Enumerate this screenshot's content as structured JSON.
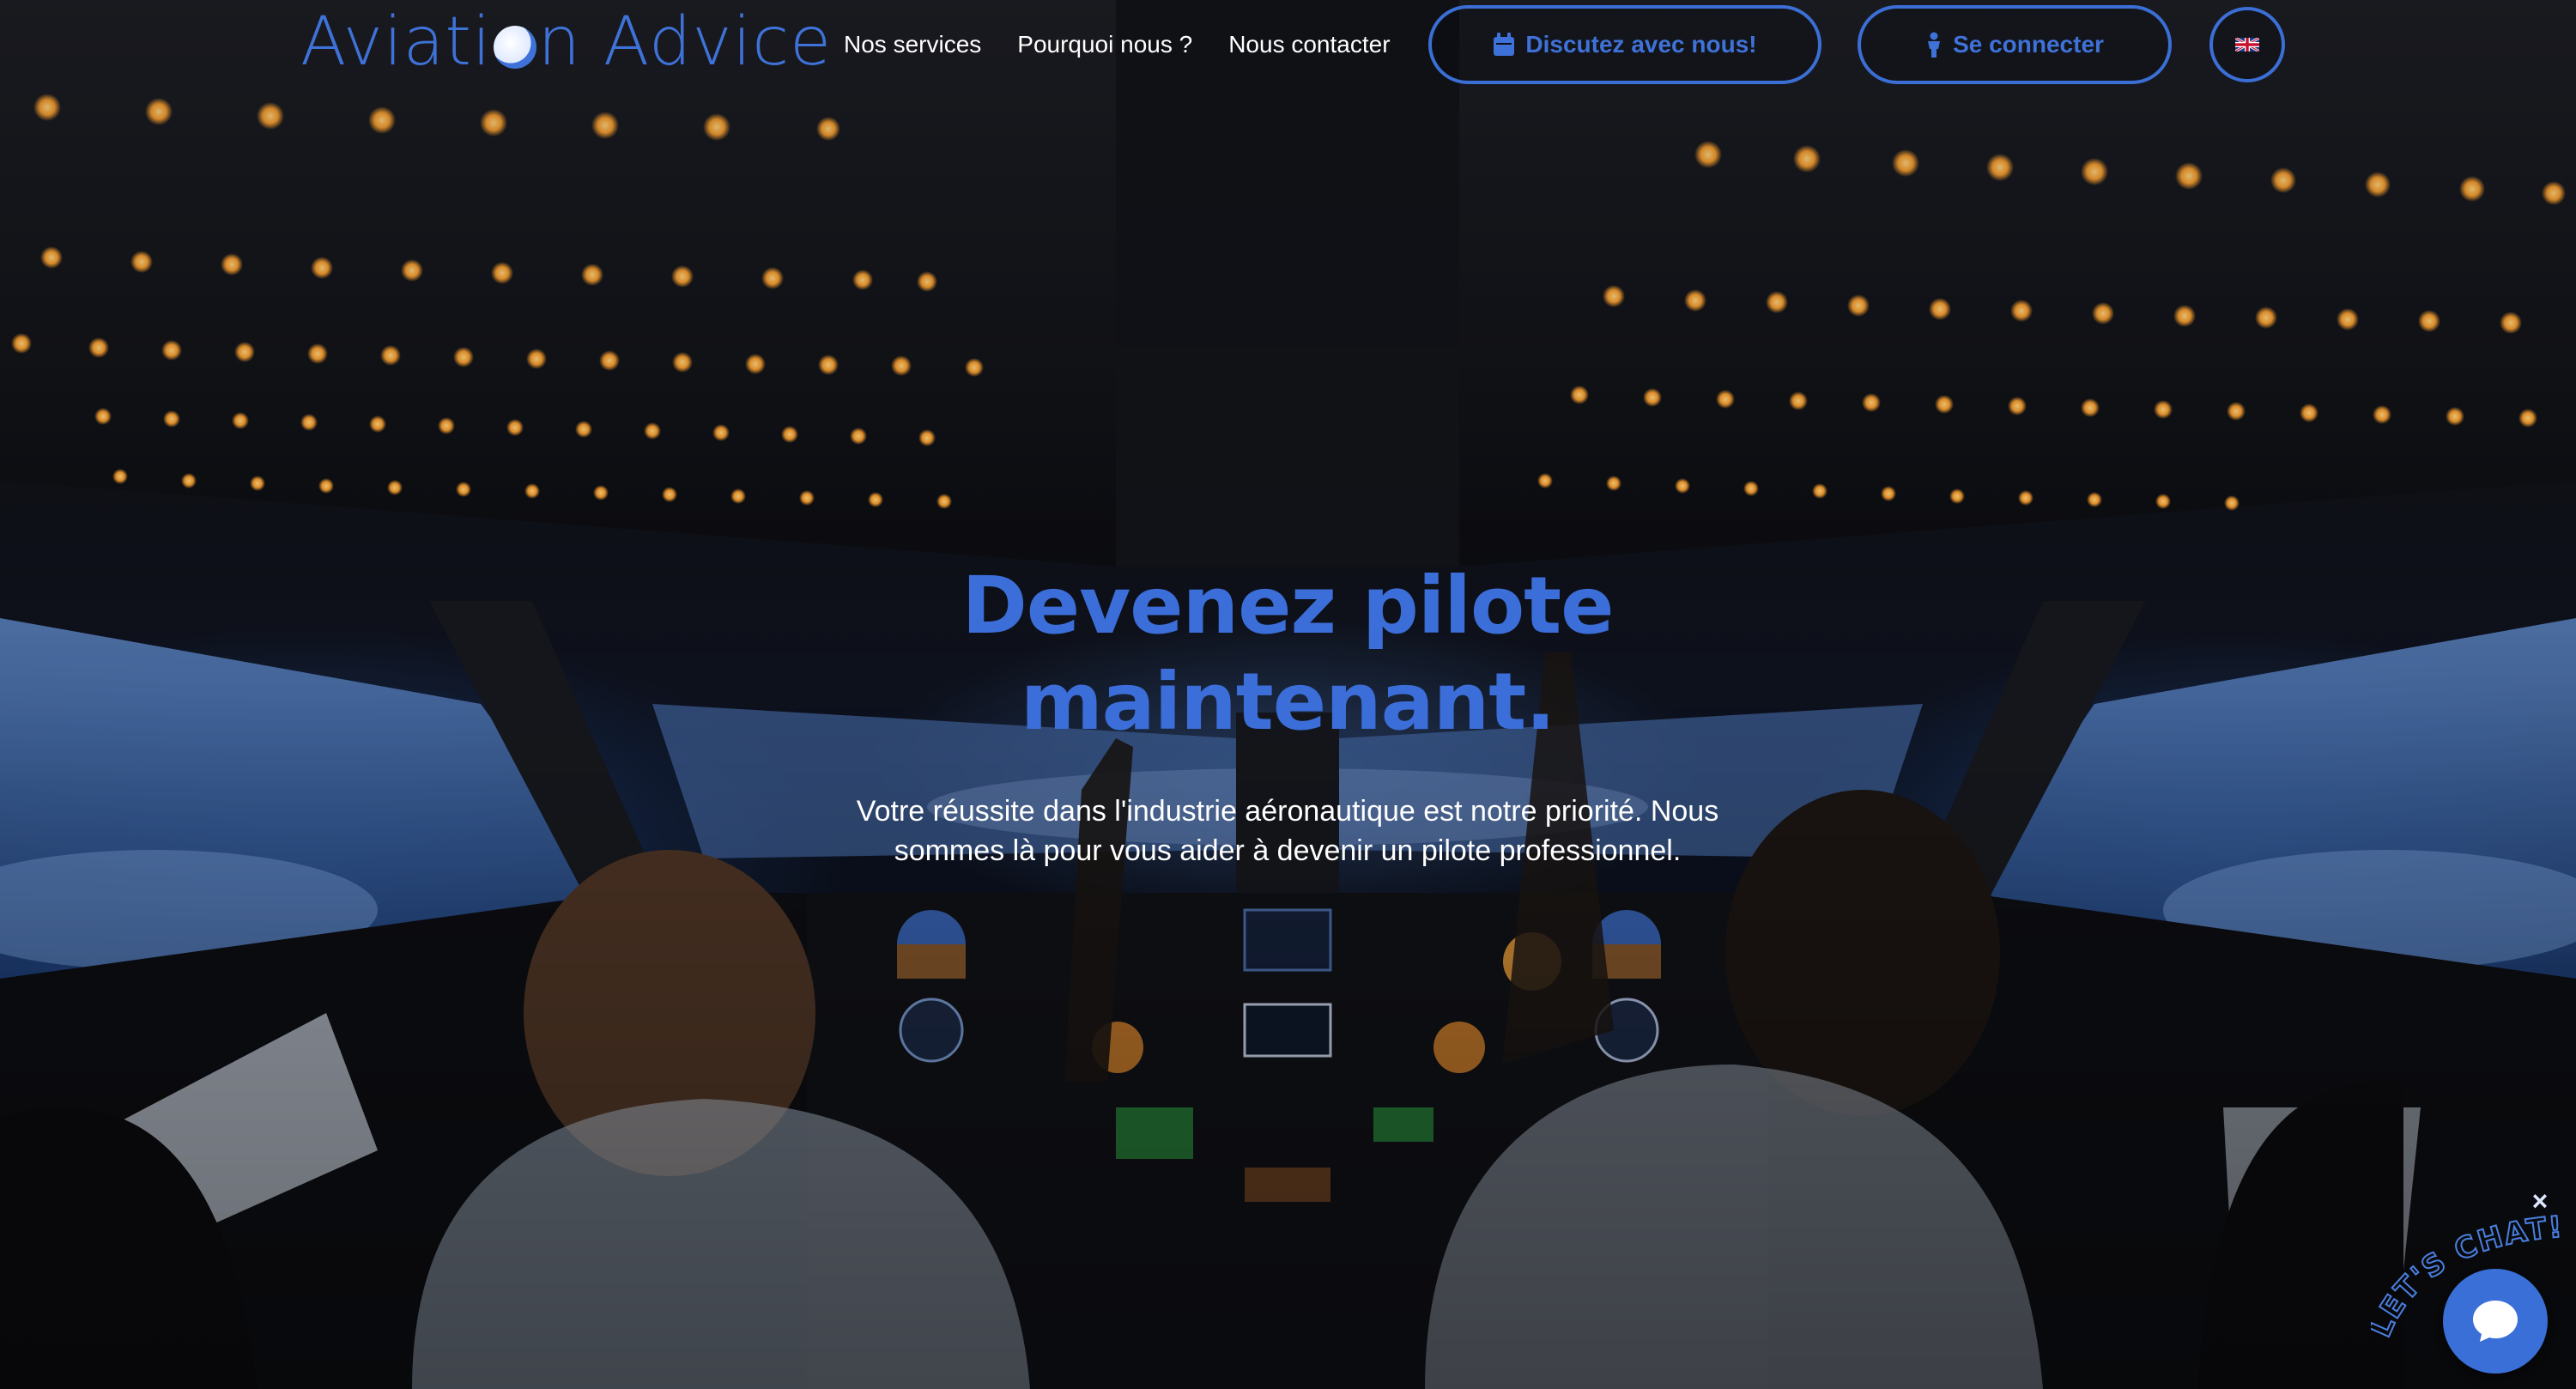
{
  "logo": {
    "text_before": "Aviati",
    "text_after": "n Advice"
  },
  "nav": {
    "links": [
      {
        "label": "Nos services"
      },
      {
        "label": "Pourquoi nous ?"
      },
      {
        "label": "Nous contacter"
      }
    ],
    "chat_button": "Discutez avec nous!",
    "login_button": "Se connecter",
    "language_icon": "uk-flag-icon"
  },
  "hero": {
    "headline_line1": "Devenez pilote",
    "headline_line2": "maintenant.",
    "subtext": "Votre réussite dans l'industrie aéronautique est notre priorité. Nous sommes là pour vous aider à devenir un pilote professionnel."
  },
  "chat_widget": {
    "lets_chat": "LET'S CHAT!",
    "close_symbol": "×",
    "icon": "chat-bubble-icon"
  },
  "colors": {
    "accent": "#3b6fd6",
    "text_light": "#ffffff",
    "background": "#05070d"
  }
}
